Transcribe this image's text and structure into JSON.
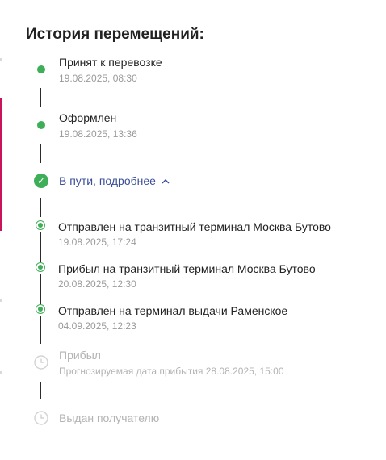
{
  "header": {
    "title": "История перемещений:"
  },
  "timeline": {
    "main_steps": [
      {
        "title": "Принят к перевозке",
        "date": "19.08.2025, 08:30",
        "status": "done"
      },
      {
        "title": "Оформлен",
        "date": "19.08.2025, 13:36",
        "status": "done"
      }
    ],
    "in_transit": {
      "label": "В пути, подробнее",
      "status": "current",
      "expanded": true,
      "icon": "check-circle-icon"
    },
    "sub_steps": [
      {
        "title": "Отправлен на транзитный терминал Москва Бутово",
        "date": "19.08.2025, 17:24"
      },
      {
        "title": "Прибыл на транзитный терминал Москва Бутово",
        "date": "20.08.2025, 12:30"
      },
      {
        "title": "Отправлен на терминал выдачи Раменское",
        "date": "04.09.2025, 12:23"
      }
    ],
    "pending_steps": [
      {
        "title": "Прибыл",
        "date": "Прогнозируемая дата прибытия 28.08.2025, 15:00",
        "icon": "clock-icon"
      },
      {
        "title": "Выдан получателю",
        "icon": "clock-icon"
      }
    ]
  },
  "colors": {
    "done": "#3fae58",
    "link": "#3a4f9a",
    "pending": "#b3b3b3",
    "line": "#2b2b2b"
  }
}
